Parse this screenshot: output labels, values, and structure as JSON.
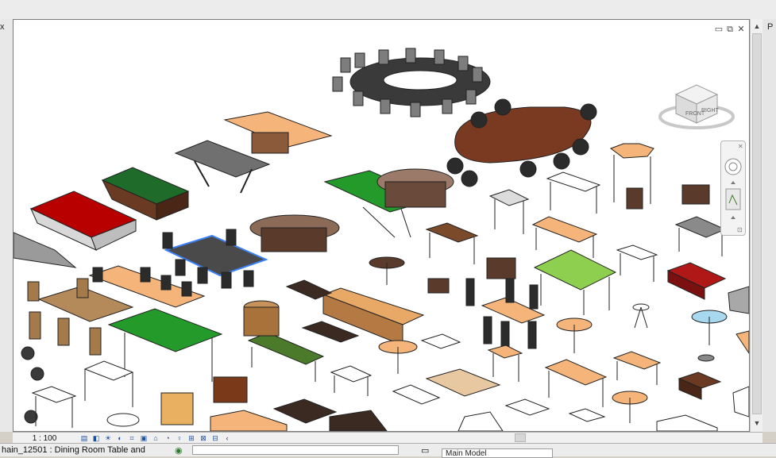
{
  "window": {
    "panel_tab_left": "x",
    "panel_tab_right": "P"
  },
  "viewport": {
    "window_controls": {
      "minimize": "▭",
      "restore": "⧉",
      "close": "✕"
    },
    "viewcube": {
      "face_front": "FRONT",
      "face_right": "RIGHT"
    }
  },
  "view_bar": {
    "scale": "1 : 100",
    "icons": [
      "detail-level-icon",
      "visual-style-icon",
      "sun-path-icon",
      "shadows-icon",
      "crop-view-icon",
      "show-crop-icon",
      "unlock-3d-icon",
      "temporary-hide-icon",
      "reveal-hidden-icon",
      "temporary-view-icon",
      "analysis-icon",
      "highlight-icon"
    ],
    "collapse": "‹"
  },
  "status_bar": {
    "selection_text": "hain_12501 : Dining Room Table and",
    "model": "Main Model"
  }
}
